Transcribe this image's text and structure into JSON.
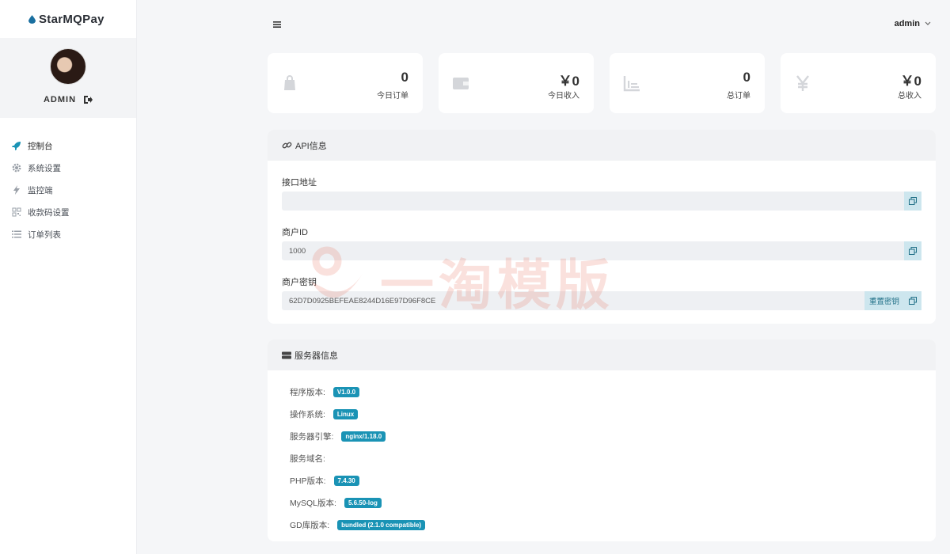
{
  "brand": {
    "name": "StarMQPay"
  },
  "profile": {
    "name": "ADMIN"
  },
  "nav": [
    {
      "label": "控制台",
      "icon": "rocket-icon",
      "active": true
    },
    {
      "label": "系统设置",
      "icon": "gear-icon"
    },
    {
      "label": "监控端",
      "icon": "bolt-icon"
    },
    {
      "label": "收款码设置",
      "icon": "grid-icon"
    },
    {
      "label": "订单列表",
      "icon": "list-icon"
    }
  ],
  "topbar": {
    "user": "admin"
  },
  "stats": [
    {
      "value": "0",
      "label": "今日订单",
      "icon": "bag-icon"
    },
    {
      "value": "￥0",
      "label": "今日收入",
      "icon": "wallet-icon"
    },
    {
      "value": "0",
      "label": "总订单",
      "icon": "chart-icon"
    },
    {
      "value": "￥0",
      "label": "总收入",
      "icon": "yen-icon"
    }
  ],
  "api": {
    "title": "API信息",
    "url_label": "接口地址",
    "url_value": "",
    "merchant_id_label": "商户ID",
    "merchant_id_value": "1000",
    "secret_label": "商户密钥",
    "secret_value": "62D7D0925BEFEAE8244D16E97D96F8CE",
    "reset_label": "重置密钥"
  },
  "server": {
    "title": "服务器信息",
    "rows": [
      {
        "label": "程序版本:",
        "value": "V1.0.0"
      },
      {
        "label": "操作系统:",
        "value": "Linux"
      },
      {
        "label": "服务器引擎:",
        "value": "nginx/1.18.0"
      },
      {
        "label": "服务域名:",
        "value": ""
      },
      {
        "label": "PHP版本:",
        "value": "7.4.30"
      },
      {
        "label": "MySQL版本:",
        "value": "5.6.50-log"
      },
      {
        "label": "GD库版本:",
        "value": "bundled (2.1.0 compatible)"
      }
    ]
  },
  "watermark": {
    "text": "一淘模版"
  },
  "colors": {
    "accent": "#1a93b5",
    "copy_bg": "#cde6ee",
    "sidebar_bg": "#ffffff",
    "page_bg": "#f5f6f8"
  }
}
